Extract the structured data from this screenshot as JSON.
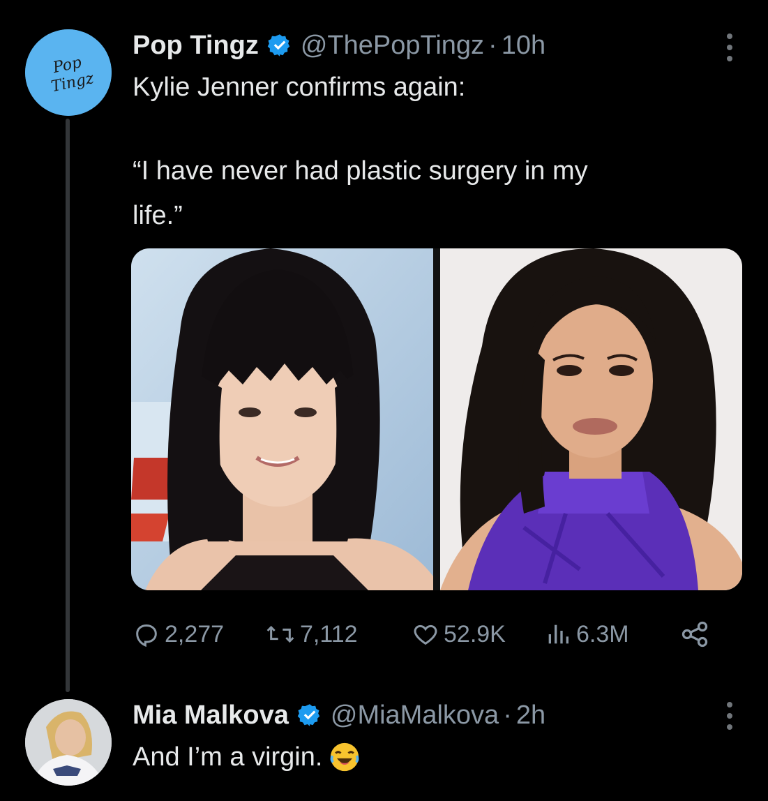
{
  "main_tweet": {
    "author_name": "Pop Tingz",
    "handle": "@ThePopTingz",
    "separator": "·",
    "time": "10h",
    "avatar_text_line1": "Pop",
    "avatar_text_line2": "Tingz",
    "text_line1": "Kylie Jenner confirms again:",
    "quote_line1": "“I have never had plastic surgery in my",
    "quote_line2": "life.”",
    "stats": {
      "replies": "2,277",
      "retweets": "7,112",
      "likes": "52.9K",
      "views": "6.3M"
    }
  },
  "reply_tweet": {
    "author_name": "Mia Malkova",
    "handle": "@MiaMalkova",
    "separator": "·",
    "time": "2h",
    "text": "And I’m a virgin."
  },
  "icons": {
    "verified": "verified-badge-icon",
    "more": "more-options-icon",
    "reply": "reply-icon",
    "retweet": "retweet-icon",
    "like": "heart-icon",
    "views": "views-icon",
    "share": "share-icon",
    "emoji": "laughing-emoji-icon"
  },
  "colors": {
    "background": "#000000",
    "text": "#e7e9ea",
    "muted": "#8b98a5",
    "verified": "#1d9bf0",
    "avatar_bg": "#5ab4f0",
    "thread_line": "#333639"
  }
}
